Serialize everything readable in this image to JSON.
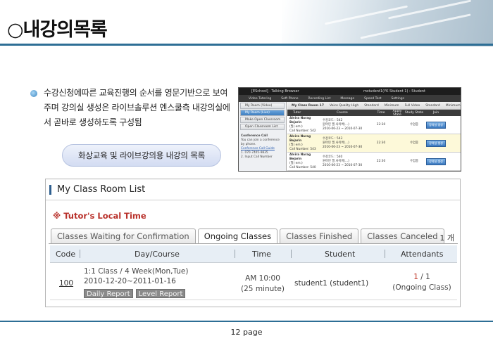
{
  "header": {
    "title": "○내강의목록"
  },
  "description": {
    "text": "수강신청에따른 교육진행의 순서를 영문기반으로 보여주며 강의실 생성은 라이브솔루션 엔스쿨측 내강의실에서 곧바로 생성하도록 구성됨",
    "caption": "화상교육 및 라이브강의용 내강의 목록"
  },
  "mini_screenshot": {
    "app_title": "[ESchool] · Talking Browser",
    "user": "mstudent1(YK Student 1) : Student",
    "toolbar": [
      "Video Tutoring",
      "Soft Phone",
      "Recording List",
      "Message",
      "Speed Test",
      "Settings"
    ],
    "sidebar": [
      "My Room (Video)",
      "My Room (Live)",
      "Make Open Classroom",
      "Open Classroom List"
    ],
    "conference": [
      "Conference Call",
      "You can join a conference",
      "by phone.",
      "Conference Call Guide",
      "1. 070-7405-9835",
      "2. Input Call Number"
    ],
    "bar": [
      "My Class Room  17",
      "Voice Quality   High",
      "Standard",
      "Minimum",
      "Full Video",
      "Standard",
      "Minimum"
    ],
    "head": [
      "Tutor",
      "Course",
      "Time",
      "Apply State",
      "Study State",
      "Join"
    ],
    "rows": [
      {
        "tutor": "Alvira Narag Bejarin",
        "sub": "(필) em:)",
        "call": "Call Number: 542",
        "course": "수강코드 : 542",
        "course2": "원어민 필 사이버(...)",
        "date": "2010-06-23 ~ 2010-07-30",
        "time": "22:30",
        "status": "수업중",
        "btn": "강의실 생성"
      },
      {
        "tutor": "Alvira Narag Bejarin",
        "sub": "(필) em:)",
        "call": "Call Number: 543",
        "course": "수강코드 : 543",
        "course2": "원어민 필 사이버(...)",
        "date": "2010-06-23 ~ 2010-07-30",
        "time": "22:30",
        "status": "수업중",
        "btn": "강의실 생성"
      },
      {
        "tutor": "Alvira Narag Bejarin",
        "sub": "(필) em:)",
        "call": "Call Number: 540",
        "course": "수강코드 : 540",
        "course2": "원어민 필 사이버(...)",
        "date": "2010-06-23 ~ 2010-07-30",
        "time": "22:30",
        "status": "수업중",
        "btn": "강의실 생성"
      }
    ]
  },
  "class_room": {
    "title": "My Class Room List",
    "tutor_time": "Tutor's Local Time",
    "tabs": [
      "Classes Waiting for Confirmation",
      "Ongoing Classes",
      "Classes Finished",
      "Classes Canceled"
    ],
    "active_tab": "Ongoing Classes",
    "count": "1 개",
    "columns": [
      "Code",
      "Day/Course",
      "Time",
      "Student",
      "Attendants"
    ],
    "row": {
      "code": "100",
      "course": "1:1 Class / 4 Week(Mon,Tue)",
      "dates": "2010-12-20~2011-01-16",
      "daily_report": "Daily Report",
      "level_report": "Level Report",
      "time_main": "AM 10:00",
      "time_duration": "(25 minute)",
      "student": "student1 (student1)",
      "attend_current": "1",
      "attend_total": " / 1",
      "attend_state": "(Ongoing Class)"
    }
  },
  "footer": {
    "page": "12 page"
  },
  "colors": {
    "accent": "#2d6e95",
    "tutor_red": "#b9312b"
  }
}
